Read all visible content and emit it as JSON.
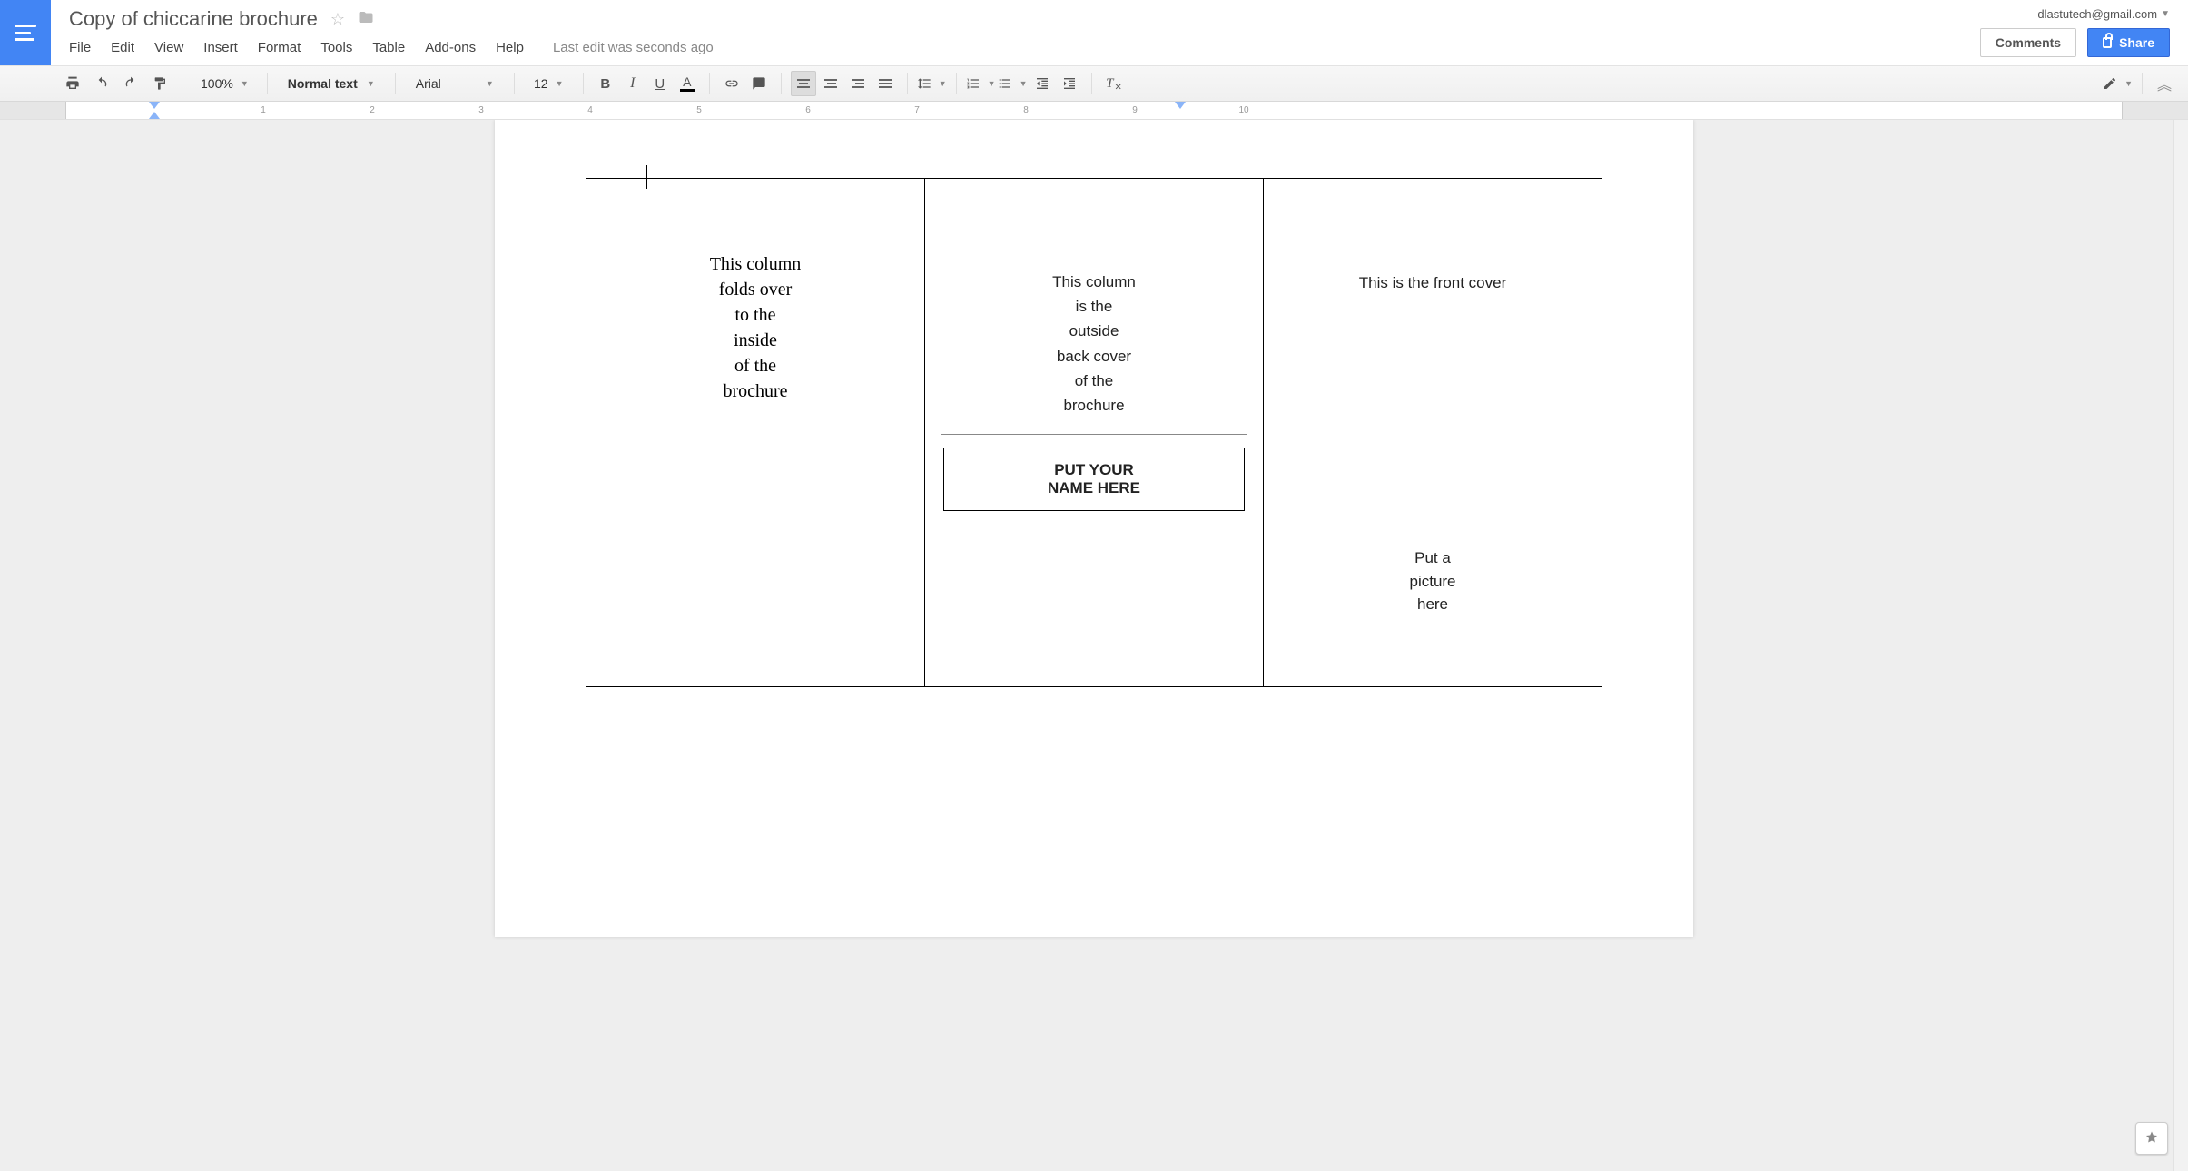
{
  "header": {
    "doc_title": "Copy of chiccarine brochure",
    "account_email": "dlastutech@gmail.com",
    "comments_label": "Comments",
    "share_label": "Share",
    "last_edit": "Last edit was seconds ago"
  },
  "menu": {
    "file": "File",
    "edit": "Edit",
    "view": "View",
    "insert": "Insert",
    "format": "Format",
    "tools": "Tools",
    "table": "Table",
    "addons": "Add-ons",
    "help": "Help"
  },
  "toolbar": {
    "zoom": "100%",
    "style": "Normal text",
    "font": "Arial",
    "font_size": "12"
  },
  "ruler": {
    "labels": [
      "1",
      "2",
      "3",
      "4",
      "5",
      "6",
      "7",
      "8",
      "9",
      "10"
    ]
  },
  "document": {
    "col1": "This column\nfolds over\nto the\ninside\nof the\nbrochure",
    "col2": "This column\nis the\noutside\nback cover\nof the\nbrochure",
    "col2_namebox": "PUT YOUR\nNAME HERE",
    "col3_top": "This is the front cover",
    "col3_pic": "Put a\npicture\nhere"
  }
}
